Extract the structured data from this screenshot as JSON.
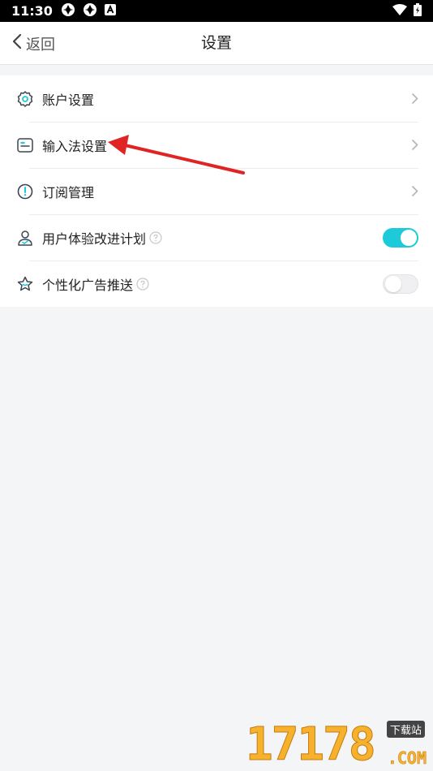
{
  "status_bar": {
    "time": "11:30",
    "icons": [
      "sync-icon",
      "sync-icon",
      "a-notification-icon",
      "wifi-icon",
      "battery-icon"
    ]
  },
  "nav": {
    "back_label": "返回",
    "title": "设置"
  },
  "settings": {
    "items": [
      {
        "label": "账户设置",
        "icon": "gear-icon",
        "control": "chevron"
      },
      {
        "label": "输入法设置",
        "icon": "keyboard-icon",
        "control": "chevron"
      },
      {
        "label": "订阅管理",
        "icon": "alert-circle-icon",
        "control": "chevron"
      },
      {
        "label": "用户体验改进计划",
        "icon": "user-icon",
        "control": "toggle",
        "enabled": true,
        "help": true
      },
      {
        "label": "个性化广告推送",
        "icon": "star-icon",
        "control": "toggle",
        "enabled": false,
        "help": true
      }
    ]
  },
  "colors": {
    "accent": "#1ccad9",
    "annotation_arrow": "#e02424",
    "background": "#f4f5f7"
  },
  "watermark": {
    "number": "17178",
    "badge": "下载站",
    "domain": ".COM"
  }
}
